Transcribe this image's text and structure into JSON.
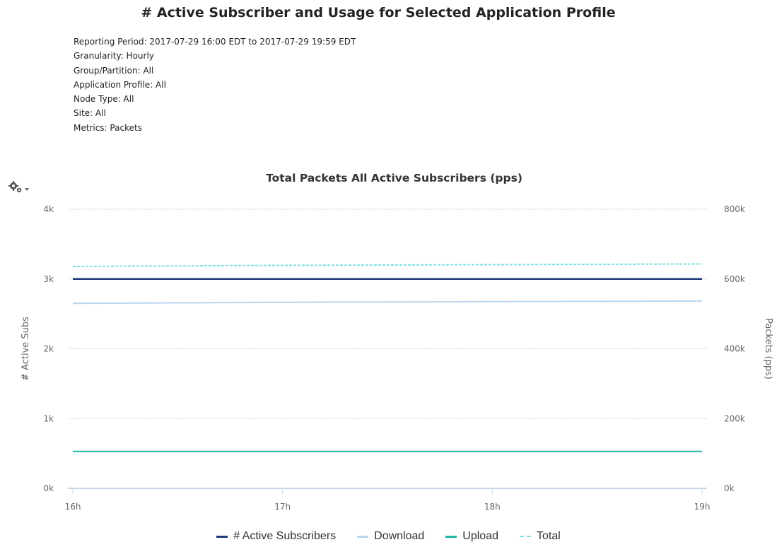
{
  "report": {
    "title": "# Active Subscriber and Usage for Selected Application Profile",
    "meta": [
      "Reporting Period: 2017-07-29 16:00 EDT to 2017-07-29 19:59 EDT",
      "Granularity: Hourly",
      "Group/Partition: All",
      "Application Profile: All",
      "Node Type: All",
      "Site: All",
      "Metrics: Packets"
    ]
  },
  "toolbar": {
    "options_icon": "gear-icon",
    "dropdown_icon": "caret-down-icon"
  },
  "chart_data": {
    "type": "line",
    "title": "Total Packets All Active Subscribers (pps)",
    "categories": [
      "16h",
      "17h",
      "18h",
      "19h"
    ],
    "y_left": {
      "label": "# Active Subs",
      "ticks": [
        "0k",
        "1k",
        "2k",
        "3k",
        "4k"
      ],
      "range": [
        0,
        4000
      ]
    },
    "y_right": {
      "label": "Packets (pps)",
      "ticks": [
        "0k",
        "200k",
        "400k",
        "600k",
        "800k"
      ],
      "range": [
        0,
        800000
      ]
    },
    "grid": true,
    "legend_position": "bottom",
    "series": [
      {
        "name": "# Active Subscribers",
        "axis": "left",
        "color": "#1f3a7a",
        "style": "solid",
        "values": [
          3000,
          3000,
          3000,
          3000
        ]
      },
      {
        "name": "Download",
        "axis": "right",
        "color": "#b9d6ee",
        "style": "solid",
        "values": [
          530000,
          533000,
          535000,
          537000
        ]
      },
      {
        "name": "Upload",
        "axis": "right",
        "color": "#1fb5a8",
        "style": "solid",
        "values": [
          106000,
          106000,
          106000,
          106000
        ]
      },
      {
        "name": "Total",
        "axis": "right",
        "color": "#7fe0e4",
        "style": "dashed",
        "values": [
          636000,
          639000,
          641000,
          643000
        ]
      }
    ]
  }
}
